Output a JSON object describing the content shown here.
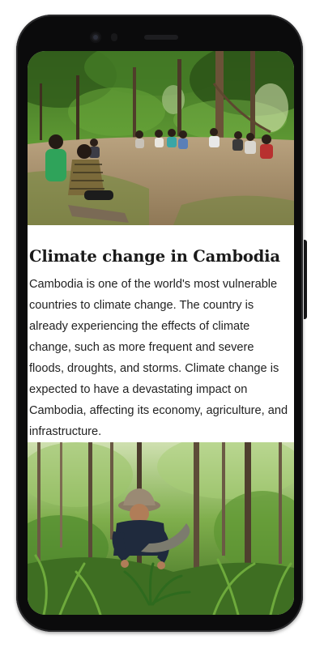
{
  "article": {
    "title": "Climate change in Cambodia",
    "body": "Cambodia is one of the world's most vulnerable countries to climate change. The country is already experiencing the effects of climate change, such as more frequent and severe floods, droughts, and storms. Climate change is expected to have a devastating impact on Cambodia, affecting its economy, agriculture, and infrastructure."
  },
  "images": {
    "top": "photo of a community meeting seated in a circle in a forest clearing",
    "bottom": "photo of a person in a bucket hat planting in a dense forest"
  },
  "colors": {
    "frame": "#0b0b0c",
    "screen_background": "#ffffff",
    "title_text": "#1a1a1a",
    "body_text": "#222222",
    "forest_green": "#4f8a2c",
    "forest_dark": "#1f3b12"
  }
}
